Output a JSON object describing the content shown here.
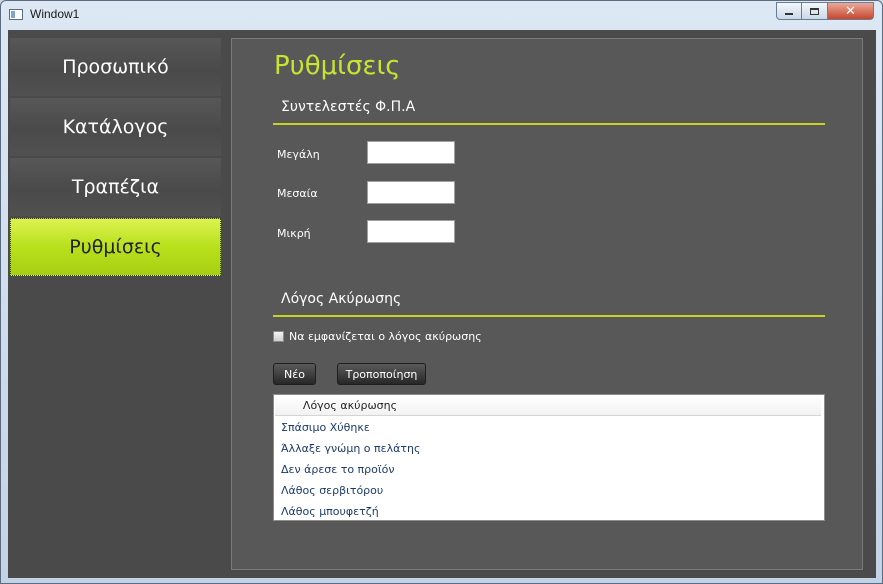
{
  "window": {
    "title": "Window1",
    "close_glyph": "✕"
  },
  "sidebar": {
    "items": [
      {
        "label": "Προσωπικό",
        "active": false
      },
      {
        "label": "Κατάλογος",
        "active": false
      },
      {
        "label": "Τραπέζια",
        "active": false
      },
      {
        "label": "Ρυθμίσεις",
        "active": true
      }
    ]
  },
  "content": {
    "title": "Ρυθμίσεις",
    "vat": {
      "header": "Συντελεστές Φ.Π.Α",
      "fields": [
        {
          "label": "Μεγάλη",
          "value": ""
        },
        {
          "label": "Μεσαία",
          "value": ""
        },
        {
          "label": "Μικρή",
          "value": ""
        }
      ]
    },
    "cancel": {
      "header": "Λόγος Ακύρωσης",
      "checkbox_label": "Να εμφανίζεται ο λόγος ακύρωσης",
      "checkbox_checked": false,
      "new_button": "Νέο",
      "edit_button": "Τροποποίηση",
      "column_header": "Λόγος ακύρωσης",
      "rows": [
        "Σπάσιμο Χύθηκε",
        "Άλλαξε γνώμη ο πελάτης",
        "Δεν άρεσε το προϊόν",
        "Λάθος σερβιτόρου",
        "Λάθος μπουφετζή"
      ]
    }
  },
  "colors": {
    "accent": "#c6e532",
    "background": "#4a4a4a",
    "panel": "#585858"
  }
}
